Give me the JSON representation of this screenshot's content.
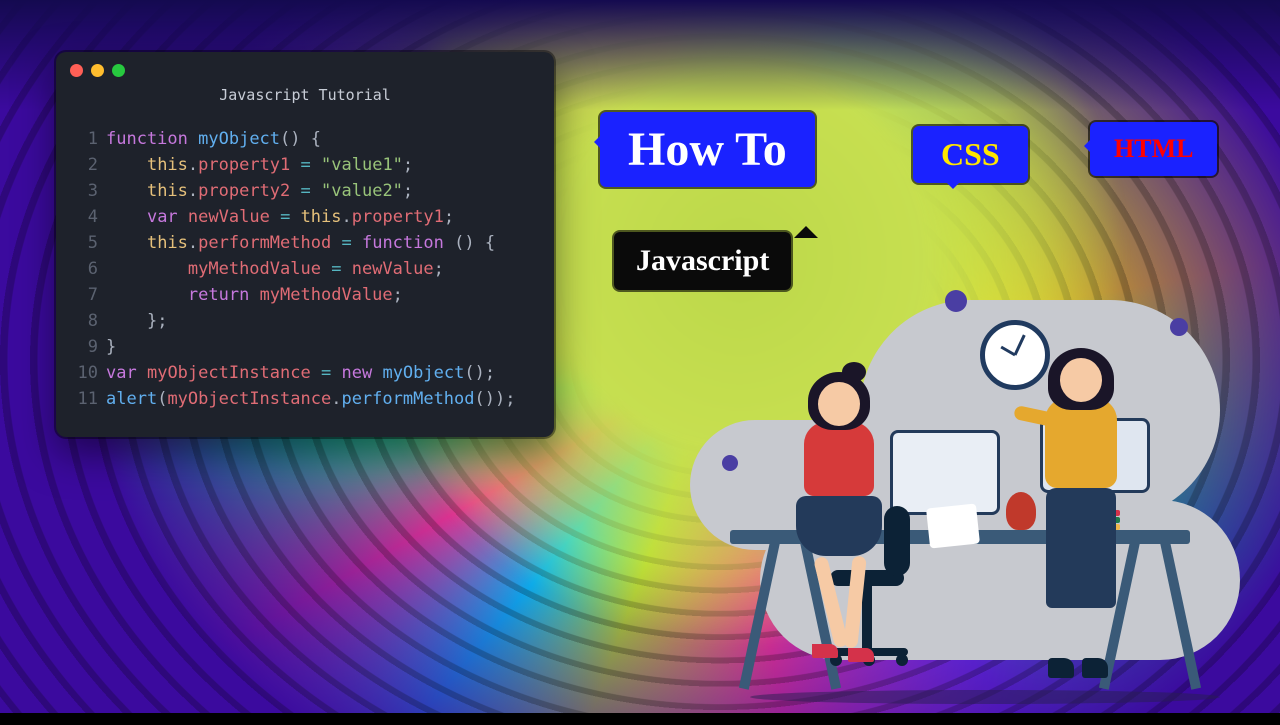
{
  "editor": {
    "title": "Javascript Tutorial",
    "lines": [
      "function myObject() {",
      "    this.property1 = \"value1\";",
      "    this.property2 = \"value2\";",
      "    var newValue = this.property1;",
      "    this.performMethod = function () {",
      "        myMethodValue = newValue;",
      "        return myMethodValue;",
      "    };",
      "}",
      "var myObjectInstance = new myObject();",
      "alert(myObjectInstance.performMethod());"
    ]
  },
  "labels": {
    "howto": "How To",
    "css": "CSS",
    "html": "HTML",
    "javascript": "Javascript"
  }
}
